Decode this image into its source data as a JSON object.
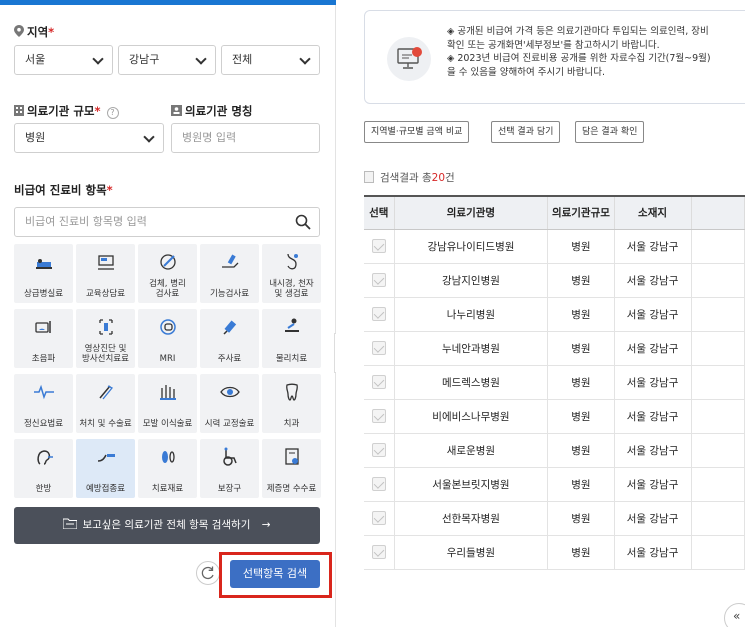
{
  "region": {
    "label": "지역",
    "required_mark": "*",
    "sido": "서울",
    "sigungu": "강남구",
    "dong": "전체"
  },
  "size": {
    "label": "의료기관 규모",
    "required_mark": "*",
    "help_icon": "?",
    "value": "병원"
  },
  "name_field": {
    "label": "의료기관 명칭",
    "placeholder": "병원명 입력"
  },
  "items": {
    "label": "비급여 진료비 항목",
    "required_mark": "*",
    "placeholder": "비급여 진료비 항목명 입력",
    "categories": [
      {
        "line1": "상급병실료",
        "line2": ""
      },
      {
        "line1": "교육상담료",
        "line2": ""
      },
      {
        "line1": "검체, 병리",
        "line2": "검사료"
      },
      {
        "line1": "기능검사료",
        "line2": ""
      },
      {
        "line1": "내시경, 천자",
        "line2": "및 생검료"
      },
      {
        "line1": "초음파",
        "line2": ""
      },
      {
        "line1": "영상진단 및",
        "line2": "방사선치료료"
      },
      {
        "line1": "MRI",
        "line2": ""
      },
      {
        "line1": "주사료",
        "line2": ""
      },
      {
        "line1": "물리치료",
        "line2": ""
      },
      {
        "line1": "정신요법료",
        "line2": ""
      },
      {
        "line1": "처치 및 수술료",
        "line2": ""
      },
      {
        "line1": "모발 이식술료",
        "line2": ""
      },
      {
        "line1": "시력 교정술료",
        "line2": ""
      },
      {
        "line1": "치과",
        "line2": ""
      },
      {
        "line1": "한방",
        "line2": ""
      },
      {
        "line1": "예방접종료",
        "line2": ""
      },
      {
        "line1": "치료재료",
        "line2": ""
      },
      {
        "line1": "보장구",
        "line2": ""
      },
      {
        "line1": "제증명 수수료",
        "line2": ""
      }
    ]
  },
  "all_items_button": "보고싶은 의료기관 전체 항목 검색하기",
  "all_items_arrow": "→",
  "search_button": "선택항목 검색",
  "notice": {
    "line1": "◈ 공개된 비급여 가격 등은 의료기관마다 투입되는 의료인력, 장비",
    "line2": "확인 또는 공개화면'세부정보'를 참고하시기 바랍니다.",
    "line3": "◈ 2023년 비급여 진료비용 공개를 위한 자료수집 기간(7월~9월)",
    "line4": "을 수 있음을 양해하여 주시기 바랍니다."
  },
  "toolbar": {
    "compare": "지역별·규모별 금액 비교",
    "add_selected": "선택 결과 담기",
    "view_saved": "담은 결과 확인"
  },
  "result": {
    "prefix": "검색결과 총",
    "count": "20",
    "suffix": "건"
  },
  "table": {
    "headers": [
      "선택",
      "의료기관명",
      "의료기관규모",
      "소재지"
    ],
    "rows": [
      {
        "name": "강남유나이티드병원",
        "size": "병원",
        "location": "서울 강남구"
      },
      {
        "name": "강남지인병원",
        "size": "병원",
        "location": "서울 강남구"
      },
      {
        "name": "나누리병원",
        "size": "병원",
        "location": "서울 강남구"
      },
      {
        "name": "누네안과병원",
        "size": "병원",
        "location": "서울 강남구"
      },
      {
        "name": "메드렉스병원",
        "size": "병원",
        "location": "서울 강남구"
      },
      {
        "name": "비에비스나무병원",
        "size": "병원",
        "location": "서울 강남구"
      },
      {
        "name": "새로운병원",
        "size": "병원",
        "location": "서울 강남구"
      },
      {
        "name": "서울본브릿지병원",
        "size": "병원",
        "location": "서울 강남구"
      },
      {
        "name": "선한목자병원",
        "size": "병원",
        "location": "서울 강남구"
      },
      {
        "name": "우리들병원",
        "size": "병원",
        "location": "서울 강남구"
      }
    ]
  },
  "corner_button": "«",
  "colors": {
    "accent": "#1976d2",
    "search_button": "#3c6fc4",
    "highlight": "#d9261c",
    "dark_button": "#4b505a"
  }
}
